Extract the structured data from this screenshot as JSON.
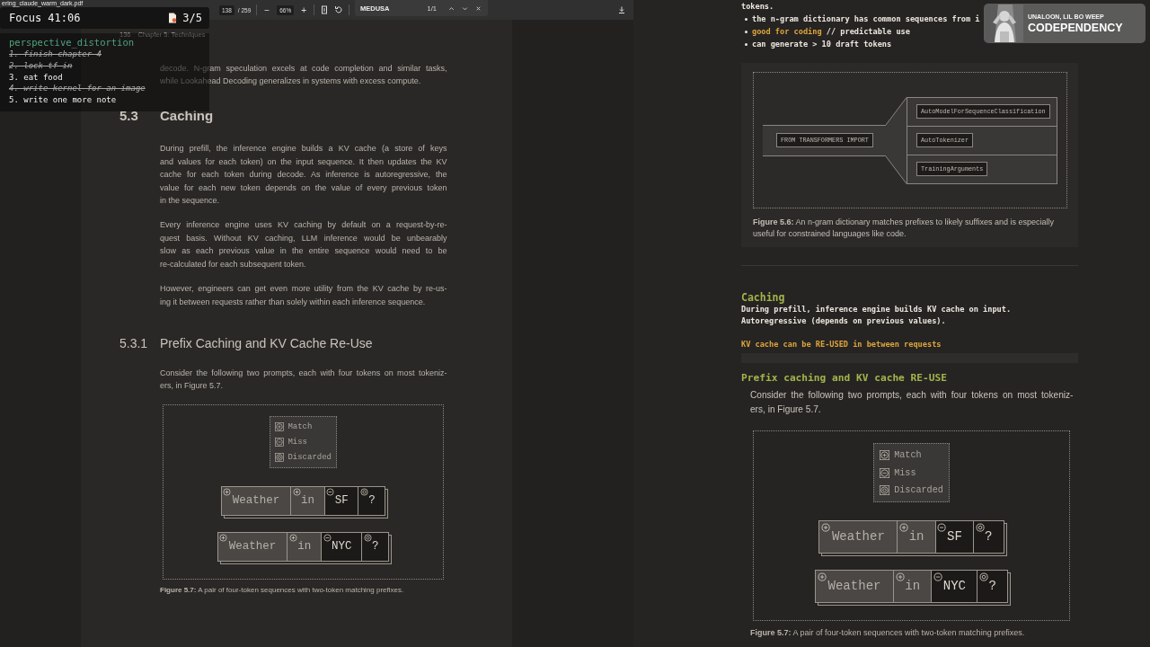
{
  "pdf_viewer": {
    "file_name": "ering_claude_warm_dark.pdf",
    "page": "138",
    "page_count": "/ 259",
    "zoom_out": "−",
    "zoom": "66%",
    "zoom_in": "+",
    "find": {
      "query": "MEDUSA",
      "matches": "1/1"
    },
    "page_header": {
      "number": "136",
      "chapter": "Chapter 5: Techniques"
    },
    "blocks": [
      {
        "kind": "paragraph",
        "lines": [
          "decode. N-gram speculation excels at code completion and similar tasks,",
          "while Lookahead Decoding generalizes in systems with excess compute."
        ]
      },
      {
        "kind": "section",
        "number": "5.3",
        "title": "Caching"
      },
      {
        "kind": "paragraph",
        "lines": [
          "During prefill, the inference engine builds a KV cache (a store of keys",
          "and values for each token) on the input sequence. It then updates the KV",
          "cache for each token during decode. As inference is autoregressive, the",
          "value for each new token depends on the value of every previous token",
          "in the sequence."
        ]
      },
      {
        "kind": "paragraph",
        "lines": [
          "Every inference engine uses KV caching by default on a request-by-re-",
          "quest basis. Without KV caching, LLM inference would be unbearably",
          "slow as each previous value in the entire sequence would need to be",
          "re-calculated for each subsequent token."
        ]
      },
      {
        "kind": "paragraph",
        "lines": [
          "However, engineers can get even more utility from the KV cache by re-us-",
          "ing it between requests rather than solely within each inference sequence."
        ]
      },
      {
        "kind": "subsection",
        "number": "5.3.1",
        "title": "Prefix Caching and KV Cache Re-Use"
      },
      {
        "kind": "paragraph",
        "lines": [
          "Consider the following two prompts, each with four tokens on most tokeniz-",
          "ers, in Figure 5.7."
        ]
      },
      {
        "kind": "figure",
        "legend": [
          {
            "label": "Match",
            "kind": "match"
          },
          {
            "label": "Miss",
            "kind": "miss"
          },
          {
            "label": "Discarded",
            "kind": "discarded"
          }
        ],
        "sequences": [
          {
            "tokens": [
              {
                "text": "Weather",
                "kind": "match"
              },
              {
                "text": "in",
                "kind": "match"
              },
              {
                "text": "SF",
                "kind": "miss"
              },
              {
                "text": "?",
                "kind": "discarded"
              }
            ]
          },
          {
            "tokens": [
              {
                "text": "Weather",
                "kind": "match"
              },
              {
                "text": "in",
                "kind": "match"
              },
              {
                "text": "NYC",
                "kind": "miss"
              },
              {
                "text": "?",
                "kind": "discarded"
              }
            ]
          }
        ],
        "caption": "**Figure 5.7:** A pair of four-token sequences with two-token matching prefixes."
      }
    ]
  },
  "overlay": {
    "timer": "Focus 41:06",
    "progress": "3/5",
    "list_title": "perspective_distortion",
    "todos": [
      {
        "text": "1. finish chapter 4",
        "done": true
      },
      {
        "text": "2. lock tf in",
        "done": true
      },
      {
        "text": "3. eat food",
        "done": false
      },
      {
        "text": "4. write kernel for an image",
        "done": true
      },
      {
        "text": "5. write one more note",
        "done": false
      }
    ]
  },
  "notes": {
    "intro": "tokens.",
    "bullets": [
      {
        "segments": [
          {
            "text": "the n-gram dictionary has common sequences from i",
            "kind": "plain"
          }
        ]
      },
      {
        "segments": [
          {
            "text": "good for coding",
            "kind": "accent"
          },
          {
            "text": " // predictable use",
            "kind": "plain"
          }
        ]
      },
      {
        "segments": [
          {
            "text": "can generate > 10 draft tokens",
            "kind": "plain"
          }
        ]
      }
    ],
    "ngram_figure": {
      "root": "FROM TRANSFORMERS IMPORT",
      "branches": [
        "AutoModelForSequenceClassification",
        "AutoTokenizer",
        "TrainingArguments"
      ],
      "caption": "**Figure 5.6:** An n-gram dictionary matches prefixes to likely suffixes and is especially useful for constrained languages like code."
    },
    "heading": "Caching",
    "lines": [
      {
        "text": "During prefill, inference engine builds KV cache on input.",
        "kind": "plain"
      },
      {
        "text": "Autoregressive (depends on previous values).",
        "kind": "plain"
      },
      {
        "text": "KV cache can be RE-USED in between requests",
        "kind": "accent"
      }
    ],
    "heading_2": "Prefix caching and KV cache RE-USE",
    "embed": {
      "paragraph": [
        "Consider the following two prompts, each with four tokens on most tokeniz-",
        "ers, in Figure 5.7."
      ],
      "figure": {
        "legend": [
          {
            "label": "Match",
            "kind": "match"
          },
          {
            "label": "Miss",
            "kind": "miss"
          },
          {
            "label": "Discarded",
            "kind": "discarded"
          }
        ],
        "sequences": [
          {
            "tokens": [
              {
                "text": "Weather",
                "kind": "match"
              },
              {
                "text": "in",
                "kind": "match"
              },
              {
                "text": "SF",
                "kind": "miss"
              },
              {
                "text": "?",
                "kind": "discarded"
              }
            ]
          },
          {
            "tokens": [
              {
                "text": "Weather",
                "kind": "match"
              },
              {
                "text": "in",
                "kind": "match"
              },
              {
                "text": "NYC",
                "kind": "miss"
              },
              {
                "text": "?",
                "kind": "discarded"
              }
            ]
          }
        ],
        "caption": "**Figure 5.7:** A pair of four-token sequences with two-token matching prefixes."
      }
    }
  },
  "now_playing": {
    "artist": "UNALOON, LIL BO WEEP",
    "title": "CODEPENDENCY"
  }
}
